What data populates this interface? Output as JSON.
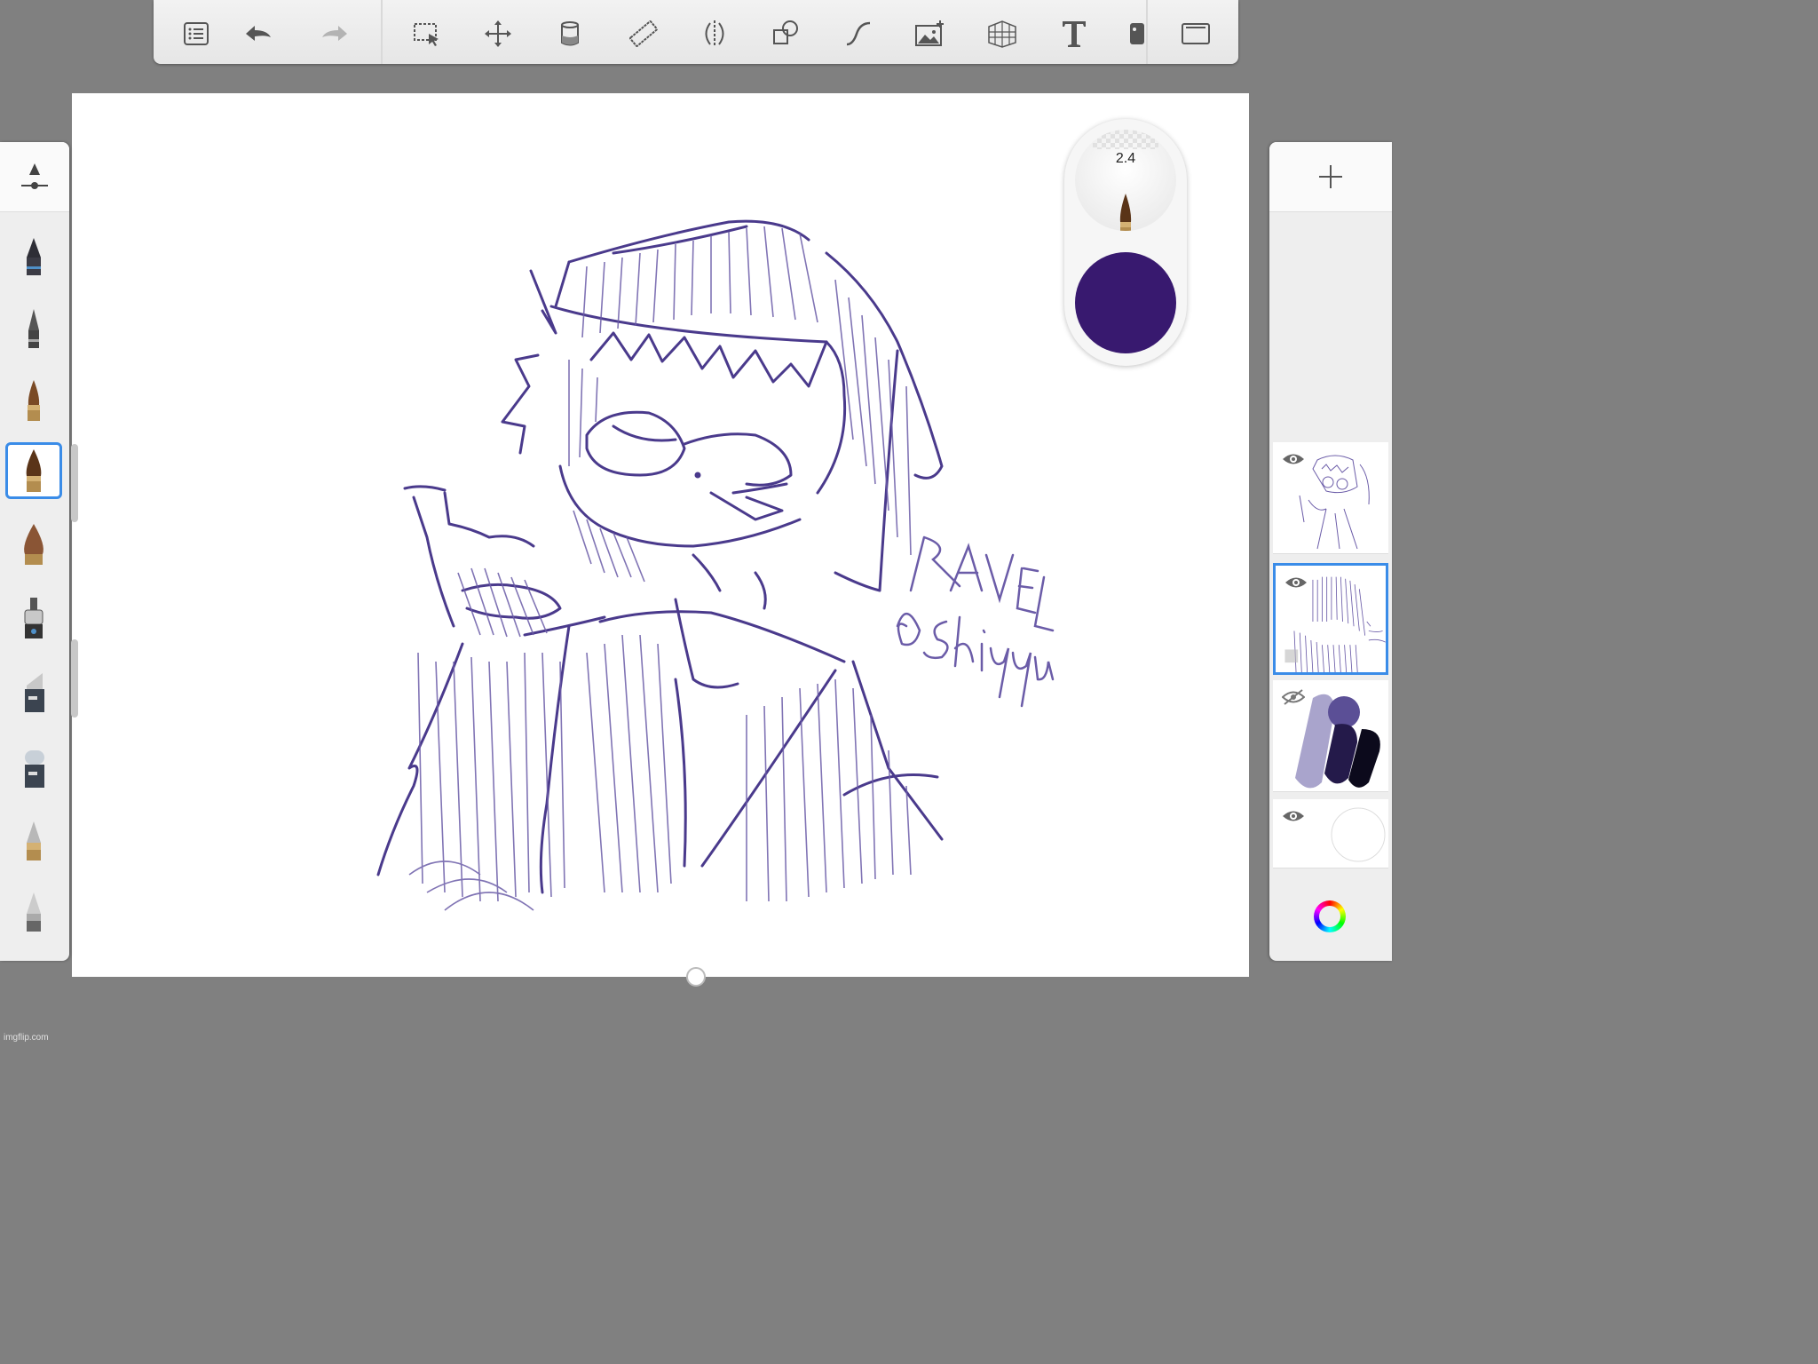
{
  "toolbar": {
    "buttons": [
      {
        "name": "list-icon"
      },
      {
        "name": "undo-icon"
      },
      {
        "name": "redo-icon"
      },
      {
        "name": "selection-icon"
      },
      {
        "name": "transform-icon"
      },
      {
        "name": "fill-icon"
      },
      {
        "name": "ruler-icon"
      },
      {
        "name": "symmetry-icon"
      },
      {
        "name": "shapes-icon"
      },
      {
        "name": "stroke-icon"
      },
      {
        "name": "image-icon"
      },
      {
        "name": "perspective-icon"
      },
      {
        "name": "text-icon"
      },
      {
        "name": "stamp-icon"
      },
      {
        "name": "fullscreen-icon"
      }
    ]
  },
  "brush_palette": {
    "brushes": [
      {
        "name": "pencil"
      },
      {
        "name": "fine-pen"
      },
      {
        "name": "fine-brush"
      },
      {
        "name": "round-brush",
        "selected": true
      },
      {
        "name": "flat-brush"
      },
      {
        "name": "airbrush"
      },
      {
        "name": "marker"
      },
      {
        "name": "eraser"
      },
      {
        "name": "blender"
      },
      {
        "name": "smudge"
      }
    ]
  },
  "puck": {
    "size": "2.4",
    "color": "#38196f"
  },
  "layers": {
    "items": [
      {
        "name": "layer-1",
        "visible": true
      },
      {
        "name": "layer-2",
        "visible": true,
        "selected": true
      },
      {
        "name": "layer-3",
        "visible": false
      },
      {
        "name": "background-layer",
        "visible": true
      }
    ]
  },
  "palette_colors": {
    "light": "#a9a4cc",
    "mid": "#5b4f96",
    "dark": "#241a4a",
    "darkest": "#0c0a1c",
    "stroke": "#4a3a8c"
  },
  "watermark": "imgflip.com"
}
